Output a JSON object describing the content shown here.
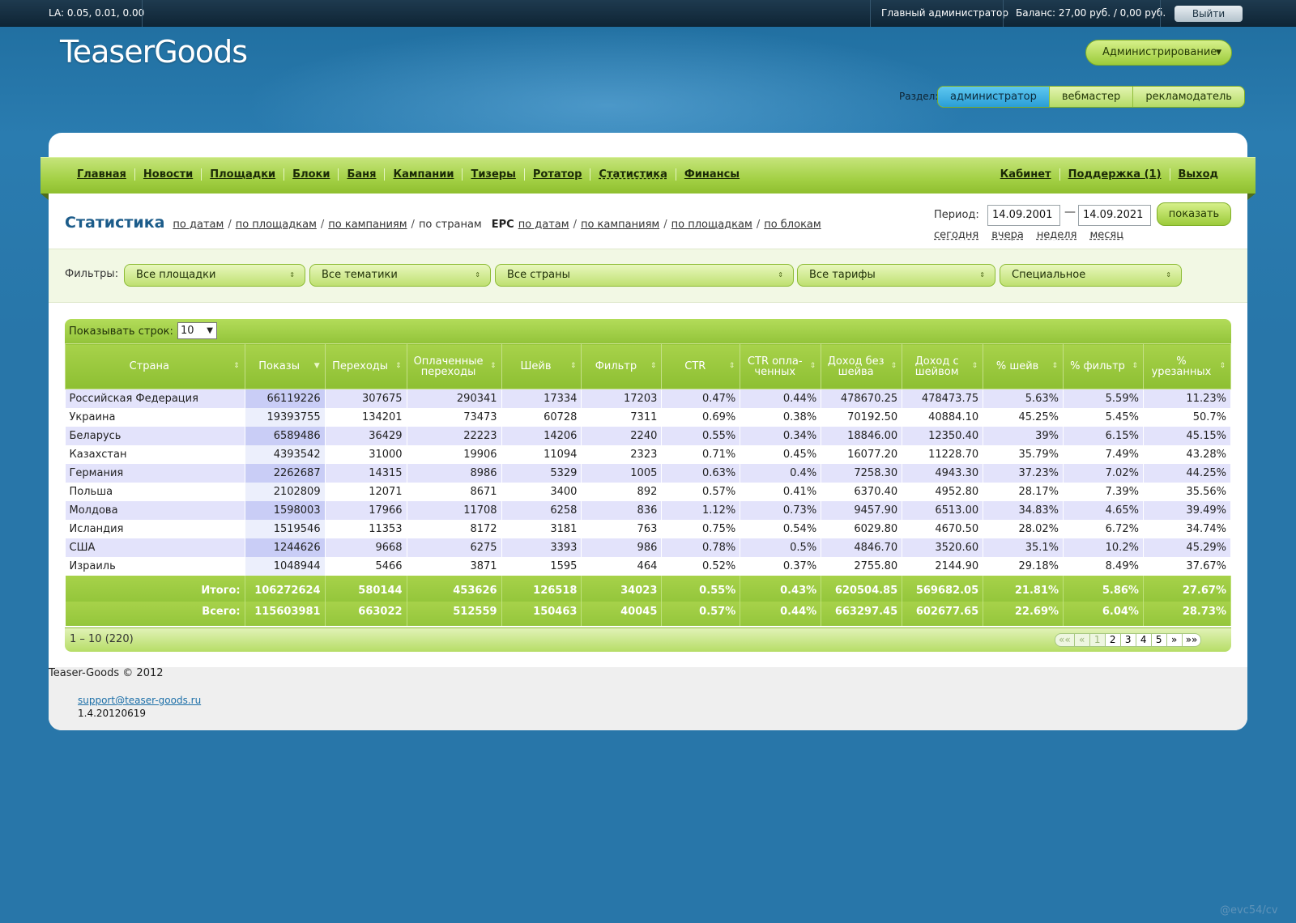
{
  "topbar": {
    "load_average": "LA: 0.05, 0.01, 0.00",
    "user_role": "Главный администратор",
    "balance": "Баланс: 27,00 руб. / 0,00 руб.",
    "logout_label": "Выйти"
  },
  "header": {
    "logo_text": "TeaserGoods",
    "admin_menu_label": "Администрирование",
    "section_label": "Раздел:",
    "sections": [
      "администратор",
      "вебмастер",
      "рекламодатель"
    ],
    "active_section": "администратор"
  },
  "nav": {
    "left": [
      "Главная",
      "Новости",
      "Площадки",
      "Блоки",
      "Баня",
      "Кампании",
      "Тизеры",
      "Ротатор",
      "Статистика",
      "Финансы"
    ],
    "right": [
      "Кабинет",
      "Поддержка (1)",
      "Выход"
    ]
  },
  "stats_header": {
    "title": "Статистика",
    "links_1": [
      "по датам",
      "по площадкам",
      "по кампаниям"
    ],
    "current": "по странам",
    "epc_label": "EPC",
    "links_2": [
      "по датам",
      "по кампаниям",
      "по площадкам",
      "по блокам"
    ],
    "period_label": "Период:",
    "date_from": "14.09.2001",
    "date_dash": "—",
    "date_to": "14.09.2021",
    "show_label": "показать",
    "quick": [
      "сегодня",
      "вчера",
      "неделя",
      "месяц"
    ]
  },
  "filters": {
    "label": "Фильтры:",
    "items": [
      "Все площадки",
      "Все тематики",
      "Все страны",
      "Все тарифы",
      "Специальное"
    ]
  },
  "table": {
    "rows_label": "Показывать строк:",
    "rows_value": "10",
    "columns": [
      "Страна",
      "Показы",
      "Переходы",
      "Оплаченные переходы",
      "Шейв",
      "Фильтр",
      "CTR",
      "CTR опла-ченных",
      "Доход без шейва",
      "Доход с шейвом",
      "% шейв",
      "% фильтр",
      "% урезанных"
    ],
    "rows": [
      [
        "Российская Федерация",
        "66119226",
        "307675",
        "290341",
        "17334",
        "17203",
        "0.47%",
        "0.44%",
        "478670.25",
        "478473.75",
        "5.63%",
        "5.59%",
        "11.23%"
      ],
      [
        "Украина",
        "19393755",
        "134201",
        "73473",
        "60728",
        "7311",
        "0.69%",
        "0.38%",
        "70192.50",
        "40884.10",
        "45.25%",
        "5.45%",
        "50.7%"
      ],
      [
        "Беларусь",
        "6589486",
        "36429",
        "22223",
        "14206",
        "2240",
        "0.55%",
        "0.34%",
        "18846.00",
        "12350.40",
        "39%",
        "6.15%",
        "45.15%"
      ],
      [
        "Казахстан",
        "4393542",
        "31000",
        "19906",
        "11094",
        "2323",
        "0.71%",
        "0.45%",
        "16077.20",
        "11228.70",
        "35.79%",
        "7.49%",
        "43.28%"
      ],
      [
        "Германия",
        "2262687",
        "14315",
        "8986",
        "5329",
        "1005",
        "0.63%",
        "0.4%",
        "7258.30",
        "4943.30",
        "37.23%",
        "7.02%",
        "44.25%"
      ],
      [
        "Польша",
        "2102809",
        "12071",
        "8671",
        "3400",
        "892",
        "0.57%",
        "0.41%",
        "6370.40",
        "4952.80",
        "28.17%",
        "7.39%",
        "35.56%"
      ],
      [
        "Молдова",
        "1598003",
        "17966",
        "11708",
        "6258",
        "836",
        "1.12%",
        "0.73%",
        "9457.90",
        "6513.00",
        "34.83%",
        "4.65%",
        "39.49%"
      ],
      [
        "Исландия",
        "1519546",
        "11353",
        "8172",
        "3181",
        "763",
        "0.75%",
        "0.54%",
        "6029.80",
        "4670.50",
        "28.02%",
        "6.72%",
        "34.74%"
      ],
      [
        "США",
        "1244626",
        "9668",
        "6275",
        "3393",
        "986",
        "0.78%",
        "0.5%",
        "4846.70",
        "3520.60",
        "35.1%",
        "10.2%",
        "45.29%"
      ],
      [
        "Израиль",
        "1048944",
        "5466",
        "3871",
        "1595",
        "464",
        "0.52%",
        "0.37%",
        "2755.80",
        "2144.90",
        "29.18%",
        "8.49%",
        "37.67%"
      ]
    ],
    "totals": [
      [
        "Итого:",
        "106272624",
        "580144",
        "453626",
        "126518",
        "34023",
        "0.55%",
        "0.43%",
        "620504.85",
        "569682.05",
        "21.81%",
        "5.86%",
        "27.67%"
      ],
      [
        "Всего:",
        "115603981",
        "663022",
        "512559",
        "150463",
        "40045",
        "0.57%",
        "0.44%",
        "663297.45",
        "602677.65",
        "22.69%",
        "6.04%",
        "28.73%"
      ]
    ],
    "range_text": "1 – 10 (220)",
    "pager": [
      "««",
      "«",
      "1",
      "2",
      "3",
      "4",
      "5",
      "»",
      "»»"
    ]
  },
  "footer": {
    "copyright": "Teaser-Goods © 2012",
    "email": "support@teaser-goods.ru",
    "version": "1.4.20120619"
  },
  "watermark": "@evc54/cv"
}
